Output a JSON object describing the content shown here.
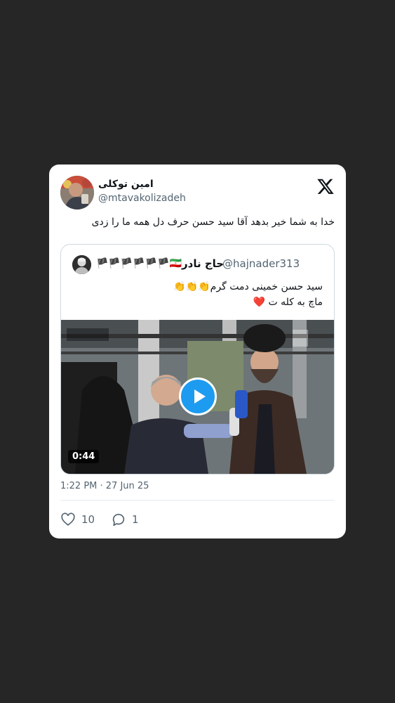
{
  "tweet": {
    "author_name": "امین توکلی",
    "author_handle": "@mtavakolizadeh",
    "text": "خدا به شما خیر بدهد آقا سید حسن حرف دل همه ما را زدی",
    "timestamp": "1:22 PM · 27 Jun 25",
    "likes": "10",
    "replies": "1"
  },
  "quote": {
    "name": "حاج نادر",
    "handle": "@hajnader313",
    "flags": "🏴🏴🏴🏴🏴🏴🇮🇷",
    "line1": "سید حسن  خمینی دمت گرم👏👏👏",
    "line2": "ماچ به کله ت",
    "line2_emoji": "❤️",
    "video_duration": "0:44"
  },
  "icons": {
    "logo": "x-logo-icon",
    "like": "heart-icon",
    "reply": "reply-bubble-icon",
    "play": "play-icon"
  },
  "colors": {
    "background": "#262626",
    "card": "#ffffff",
    "accent": "#1d9bf0",
    "secondary_text": "#536471"
  }
}
